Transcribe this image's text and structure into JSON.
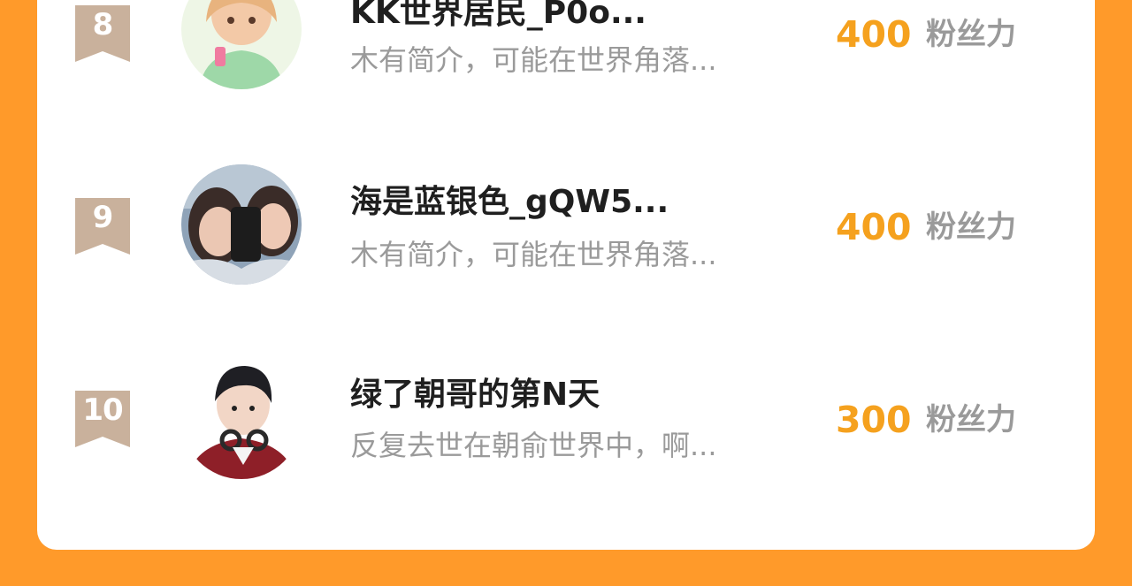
{
  "leaderboard": {
    "score_unit": "粉丝力",
    "entries": [
      {
        "rank": "8",
        "username": "KK世界居民_P0o...",
        "bio": "木有简介，可能在世界角落...",
        "score": "400",
        "avatar_icon": "anime-girl-avatar"
      },
      {
        "rank": "9",
        "username": "海是蓝银色_gQW5...",
        "bio": "木有简介，可能在世界角落...",
        "score": "400",
        "avatar_icon": "selfie-photo-avatar"
      },
      {
        "rank": "10",
        "username": "绿了朝哥的第N天",
        "bio": "反复去世在朝俞世界中，啊...",
        "score": "300",
        "avatar_icon": "anime-boy-headphones-avatar"
      }
    ]
  },
  "colors": {
    "background": "#FF9A2A",
    "card": "#FFFFFF",
    "score": "#F5A11E",
    "badge": "#C9B19C",
    "muted_text": "#9A9A9A"
  }
}
